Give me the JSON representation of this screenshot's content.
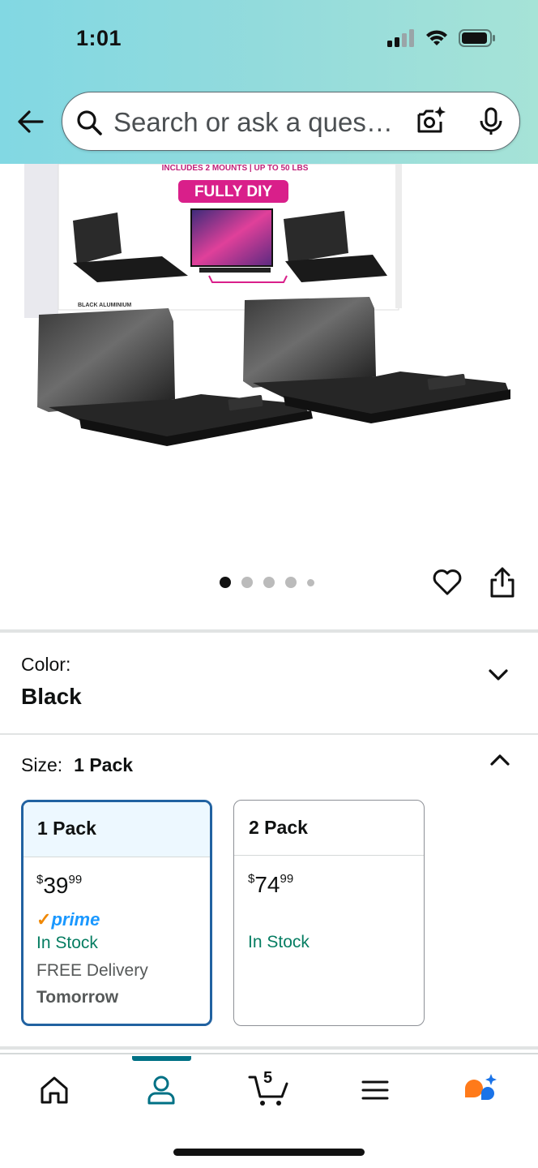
{
  "status_bar": {
    "time": "1:01"
  },
  "search": {
    "placeholder": "Search or ask a question"
  },
  "product_image": {
    "banner_text": "INCLUDES 2 MOUNTS | UP TO 50 LBS",
    "badge_text": "FULLY DIY",
    "box_label": "BLACK ALUMINIUM"
  },
  "image_carousel": {
    "total": 5,
    "current": 1
  },
  "color": {
    "label": "Color:",
    "value": "Black"
  },
  "size": {
    "label": "Size:",
    "selected": "1 Pack",
    "options": [
      {
        "name": "1 Pack",
        "price_whole": "39",
        "price_cents": "99",
        "currency": "$",
        "prime": "prime",
        "stock": "In Stock",
        "delivery": "FREE Delivery",
        "delivery_day": "Tomorrow"
      },
      {
        "name": "2 Pack",
        "price_whole": "74",
        "price_cents": "99",
        "currency": "$",
        "stock": "In Stock"
      }
    ]
  },
  "bottom_nav": {
    "items": [
      "home-icon",
      "account-icon",
      "cart-icon",
      "menu-icon",
      "rufus-icon"
    ],
    "active_index": 1,
    "cart_count": "5"
  },
  "colors": {
    "accent": "#007185",
    "selected_border": "#2162a1",
    "in_stock": "#067d62",
    "prime": "#1a98ff"
  }
}
